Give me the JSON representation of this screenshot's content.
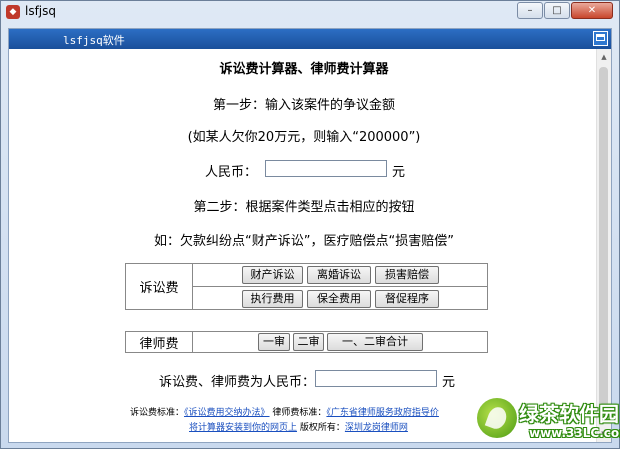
{
  "window": {
    "title": "lsfjsq",
    "minimize": "–",
    "maximize": "□",
    "close": "✕"
  },
  "header": {
    "title": "lsfjsq软件"
  },
  "calculator": {
    "heading": "诉讼费计算器、律师费计算器",
    "step1": "第一步：输入该案件的争议金额",
    "example1": "(如某人欠你20万元，则输入“200000”)",
    "rmb_label": "人民币：",
    "rmb_value": "",
    "unit": "元",
    "step2": "第二步：根据案件类型点击相应的按钮",
    "example2": "如：欠款纠纷点“财产诉讼”，医疗赔偿点“损害赔偿”"
  },
  "litigation_fee": {
    "label": "诉讼费",
    "buttons": [
      "财产诉讼",
      "离婚诉讼",
      "损害赔偿",
      "执行费用",
      "保全费用",
      "督促程序"
    ]
  },
  "lawyer_fee": {
    "label": "律师费",
    "buttons": [
      "一审",
      "二审",
      "一、二审合计"
    ]
  },
  "result": {
    "label": "诉讼费、律师费为人民币：",
    "value": "",
    "unit": "元"
  },
  "footer": {
    "litigation_standard_label": "诉讼费标准：",
    "litigation_standard_link": "《诉讼费用交纳办法》",
    "lawyer_standard_label": "律师费标准：",
    "lawyer_standard_link": "《广东省律师服务政府指导价",
    "install_link": "将计算器安装到你的网页上",
    "copyright_label": "版权所有：",
    "copyright_link": "深圳龙岗律师网"
  },
  "watermark": {
    "name": "绿茶软件园",
    "url": "www.33LC.com"
  },
  "colors": {
    "header_blue": "#1f5aa8",
    "link_blue": "#1a4fbf",
    "watermark_green": "#4a9a12"
  }
}
